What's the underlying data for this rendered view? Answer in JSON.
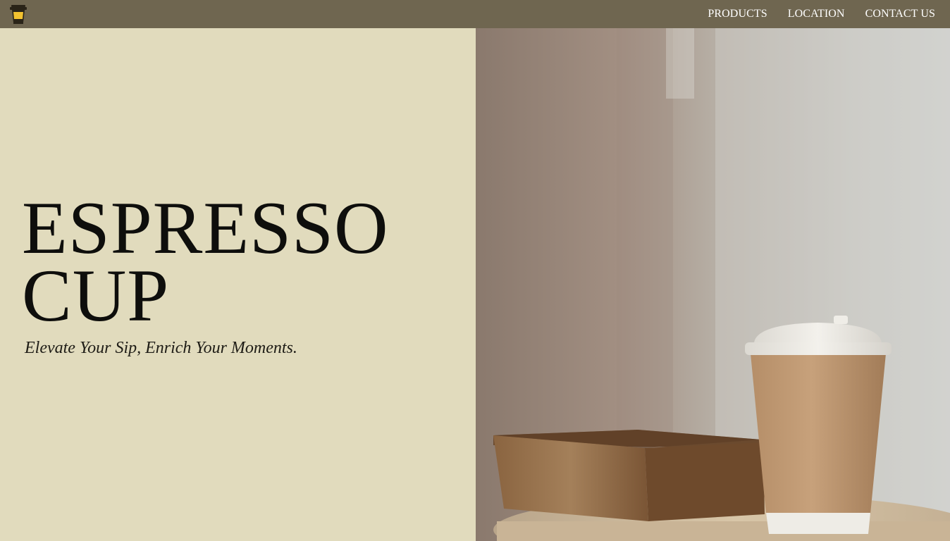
{
  "header": {
    "logo_icon": "coffee-cup-icon",
    "nav": [
      {
        "label": "PRODUCTS"
      },
      {
        "label": "LOCATION"
      },
      {
        "label": "CONTACT US"
      }
    ]
  },
  "hero": {
    "title_line1": "ESPRESSO",
    "title_line2": "CUP",
    "tagline": "Elevate Your Sip, Enrich Your Moments."
  },
  "colors": {
    "navbar": "#6f6650",
    "hero_left_bg": "#e1dbbd",
    "title_text": "#0e0e0c"
  }
}
